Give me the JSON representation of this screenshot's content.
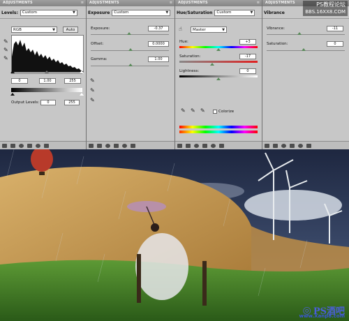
{
  "panels": [
    {
      "title": "ADJUSTMENTS",
      "label": "Levels:",
      "preset": "Custom"
    },
    {
      "title": "ADJUSTMENTS",
      "label": "Exposure",
      "preset": "Custom"
    },
    {
      "title": "ADJUSTMENTS",
      "label": "Hue/Saturation",
      "preset": "Custom"
    },
    {
      "title": "ADJUSTMENTS",
      "label": "Vibrance",
      "preset": ""
    }
  ],
  "levels": {
    "channel": "RGB",
    "auto_label": "Auto",
    "input_black": "0",
    "input_gamma": "1.00",
    "input_white": "255",
    "output_label": "Output Levels:",
    "output_black": "0",
    "output_white": "255"
  },
  "exposure": {
    "exposure_label": "Exposure:",
    "exposure_value": "-0.37",
    "offset_label": "Offset:",
    "offset_value": "0.0000",
    "gamma_label": "Gamma:",
    "gamma_value": "1.00"
  },
  "huesat": {
    "channel": "Master",
    "hue_label": "Hue:",
    "hue_value": "+3",
    "sat_label": "Saturation:",
    "sat_value": "-17",
    "light_label": "Lightness:",
    "light_value": "0",
    "colorize_label": "Colorize"
  },
  "vibrance": {
    "vibrance_label": "Vibrance:",
    "vibrance_value": "-11",
    "sat_label": "Saturation:",
    "sat_value": "0"
  },
  "watermark": {
    "line1": "PS教程论坛",
    "line2": "BBS.16XX8.COM"
  },
  "logo": {
    "text": "PS酒吧",
    "url": "www.Xanp8.com"
  },
  "colors": {
    "panel": "#c7c7c7",
    "sky": "#2a3a5a",
    "field": "#c49a52",
    "grass": "#3f7a28",
    "logo": "#4a5fd8"
  }
}
